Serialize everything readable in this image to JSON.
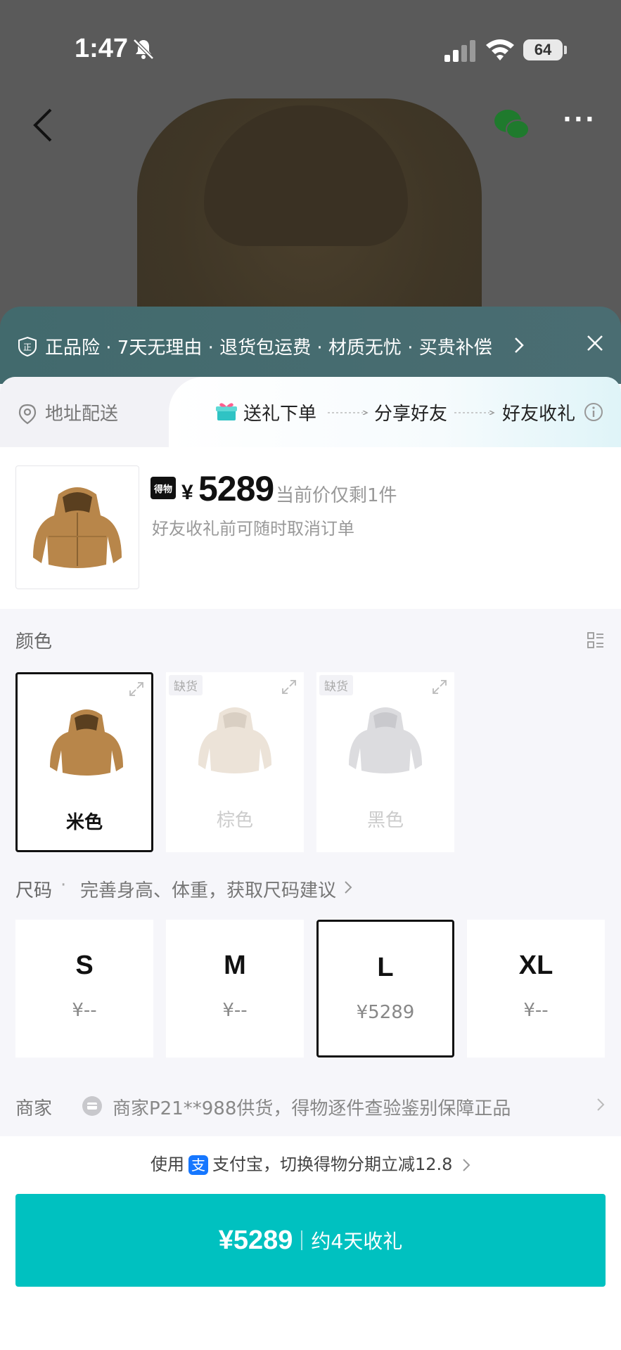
{
  "status_bar": {
    "time": "1:47",
    "battery": "64"
  },
  "guarantee": {
    "text": "正品险 · 7天无理由 · 退货包运费 · 材质无忧 · 买贵补偿"
  },
  "gift_flow": {
    "address_label": "地址配送",
    "step1": "送礼下单",
    "step2": "分享好友",
    "step3": "好友收礼"
  },
  "product": {
    "currency": "¥",
    "price": "5289",
    "stock_note": "当前价仅剩1件",
    "cancel_note": "好友收礼前可随时取消订单",
    "brand_badge": "得物"
  },
  "color_section": {
    "label": "颜色",
    "options": [
      {
        "name": "米色",
        "tag": "",
        "selected": true
      },
      {
        "name": "棕色",
        "tag": "缺货",
        "selected": false
      },
      {
        "name": "黑色",
        "tag": "缺货",
        "selected": false
      }
    ]
  },
  "size_section": {
    "label": "尺码",
    "hint": "完善身高、体重，获取尺码建议",
    "options": [
      {
        "size": "S",
        "price": "¥--"
      },
      {
        "size": "M",
        "price": "¥--"
      },
      {
        "size": "L",
        "price": "¥5289",
        "selected": true
      },
      {
        "size": "XL",
        "price": "¥--"
      }
    ]
  },
  "merchant": {
    "label": "商家",
    "text": "商家P21**988供货，得物逐件查验鉴别保障正品"
  },
  "payment": {
    "prefix": "使用",
    "alipay_glyph": "支",
    "suffix": "支付宝，切换得物分期立减12.8"
  },
  "buy_button": {
    "price": "¥5289",
    "eta": "约4天收礼"
  },
  "colors": {
    "accent": "#00c1c0",
    "coat": "#b8864a",
    "alipay": "#1677ff"
  }
}
